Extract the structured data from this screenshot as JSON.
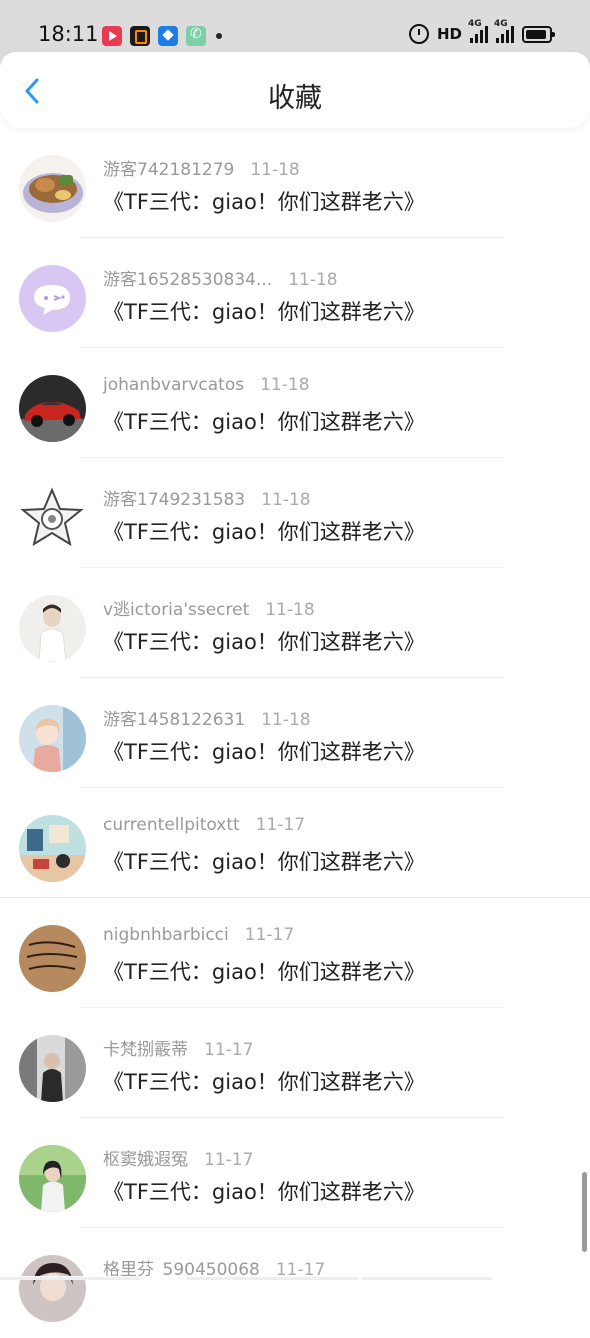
{
  "status_bar": {
    "time": "18:11",
    "notification_icons": [
      "video-app-icon",
      "orange-app-icon",
      "blue-app-icon",
      "phone-app-icon"
    ],
    "hd_label": "HD",
    "network_1": "4G",
    "network_2": "4G"
  },
  "header": {
    "title": "收藏",
    "back_icon": "chevron-left-icon",
    "accent_color": "#2b9af3"
  },
  "favorites": [
    {
      "user": "游客742181279",
      "date": "11-18",
      "title": "《TF三代：giao！你们这群老六》",
      "avatar": "food-avatar"
    },
    {
      "user": "游客16528530834...",
      "date": "11-18",
      "title": "《TF三代：giao！你们这群老六》",
      "avatar": "purple-chat-avatar"
    },
    {
      "user": "johanbvarvcatos",
      "date": "11-18",
      "title": "《TF三代：giao！你们这群老六》",
      "avatar": "red-car-avatar"
    },
    {
      "user": "游客1749231583",
      "date": "11-18",
      "title": "《TF三代：giao！你们这群老六》",
      "avatar": "star-avatar"
    },
    {
      "user": "v逃ictoria'ssecret",
      "date": "11-18",
      "title": "《TF三代：giao！你们这群老六》",
      "avatar": "white-shirt-avatar"
    },
    {
      "user": "游客1458122631",
      "date": "11-18",
      "title": "《TF三代：giao！你们这群老六》",
      "avatar": "anime-girl-avatar"
    },
    {
      "user": "currentellpitoxtt",
      "date": "11-17",
      "title": "《TF三代：giao！你们这群老六》",
      "avatar": "illustration-avatar"
    },
    {
      "user": "nigbnhbarbicci",
      "date": "11-17",
      "title": "《TF三代：giao！你们这群老六》",
      "avatar": "handwriting-avatar"
    },
    {
      "user": "卡梵捌霰蒂",
      "date": "11-17",
      "title": "《TF三代：giao！你们这群老六》",
      "avatar": "street-photo-avatar"
    },
    {
      "user": "枢窦娥遐冤",
      "date": "11-17",
      "title": "《TF三代：giao！你们这群老六》",
      "avatar": "green-portrait-avatar"
    },
    {
      "user": "格里芬_590450068",
      "date": "11-17",
      "title": "",
      "avatar": "dark-hair-avatar"
    }
  ]
}
